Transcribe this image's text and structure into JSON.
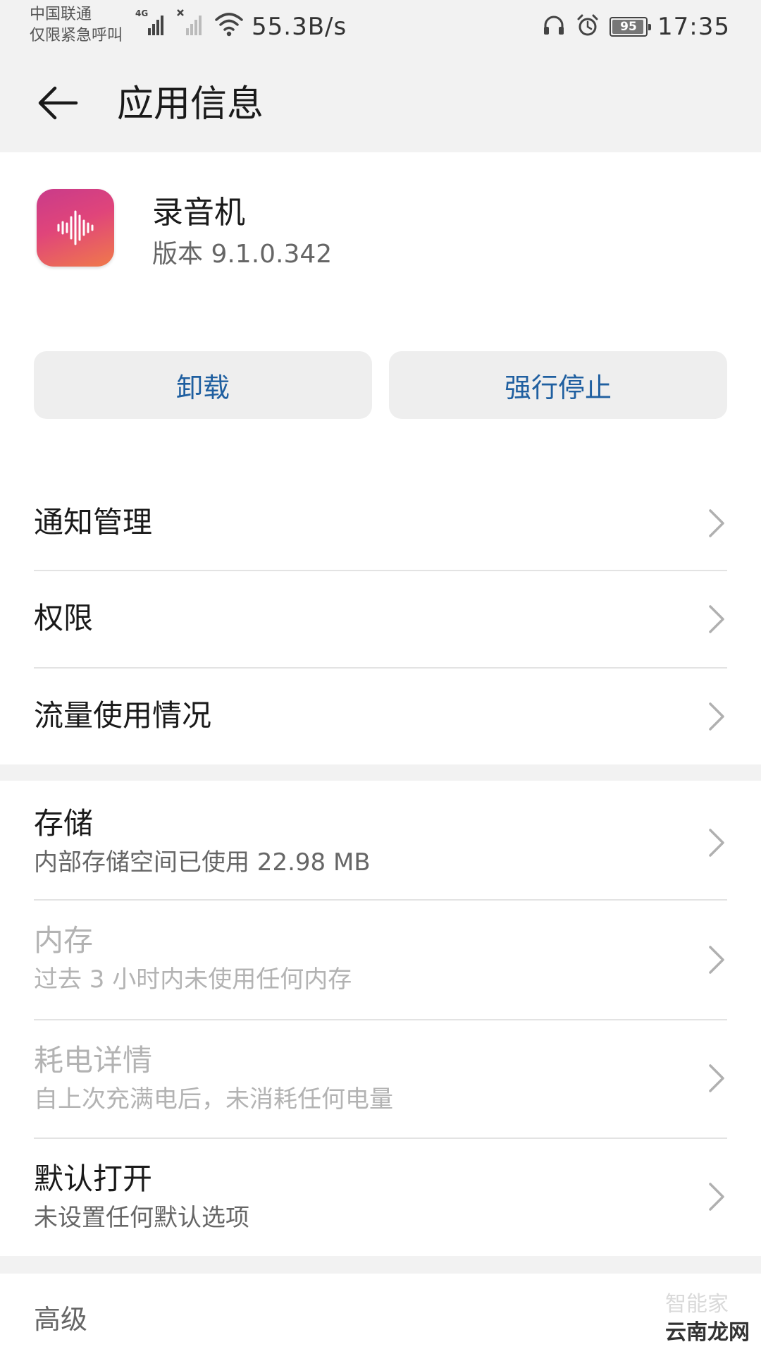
{
  "status_bar": {
    "carrier_line1": "中国联通",
    "carrier_line2": "仅限紧急呼叫",
    "network_type": "4G",
    "net_speed": "55.3B/s",
    "battery_level": 95,
    "battery_text": "95",
    "time": "17:35",
    "icons": [
      "signal-4g-icon",
      "signal-no-sim-icon",
      "wifi-icon",
      "headset-icon",
      "alarm-icon",
      "battery-icon"
    ]
  },
  "header": {
    "title": "应用信息"
  },
  "app": {
    "name": "录音机",
    "version": "版本 9.1.0.342"
  },
  "actions": {
    "uninstall": "卸载",
    "force_stop": "强行停止",
    "color": "#1f5fa0"
  },
  "settings": {
    "notifications": "通知管理",
    "permissions": "权限",
    "data_usage": "流量使用情况"
  },
  "details": {
    "storage_title": "存储",
    "storage_sub": "内部存储空间已使用 22.98 MB",
    "memory_title": "内存",
    "memory_sub": "过去 3 小时内未使用任何内存",
    "battery_title": "耗电详情",
    "battery_sub": "自上次充满电后，未消耗任何电量",
    "default_title": "默认打开",
    "default_sub": "未设置任何默认选项"
  },
  "advanced": {
    "label": "高级"
  },
  "watermark": {
    "part1": "智能家",
    "part2": "云南龙网"
  }
}
